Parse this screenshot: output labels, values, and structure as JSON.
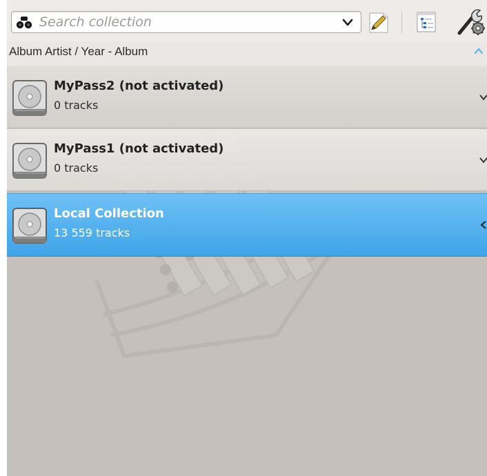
{
  "search": {
    "placeholder": "Search collection",
    "icon": "binoculars-icon"
  },
  "toolbar": {
    "edit_filter_icon": "edit-filter-icon",
    "merged_view_icon": "tree-view-icon",
    "config_icon": "configure-tools-icon"
  },
  "groupby": {
    "label": "Album Artist / Year - Album"
  },
  "collections": [
    {
      "name": "MyPass2 (not activated)",
      "tracks": "0 tracks",
      "icon": "hard-drive-icon",
      "selected": false
    },
    {
      "name": "MyPass1 (not activated)",
      "tracks": "0 tracks",
      "icon": "hard-drive-icon",
      "selected": false
    },
    {
      "name": "Local Collection",
      "tracks": "13 559 tracks",
      "icon": "hard-drive-icon",
      "selected": true
    }
  ],
  "colors": {
    "selection": "#3ea4e8",
    "panel_bg": "#c5c0bc",
    "toolbar_bg": "#eeebe8"
  }
}
